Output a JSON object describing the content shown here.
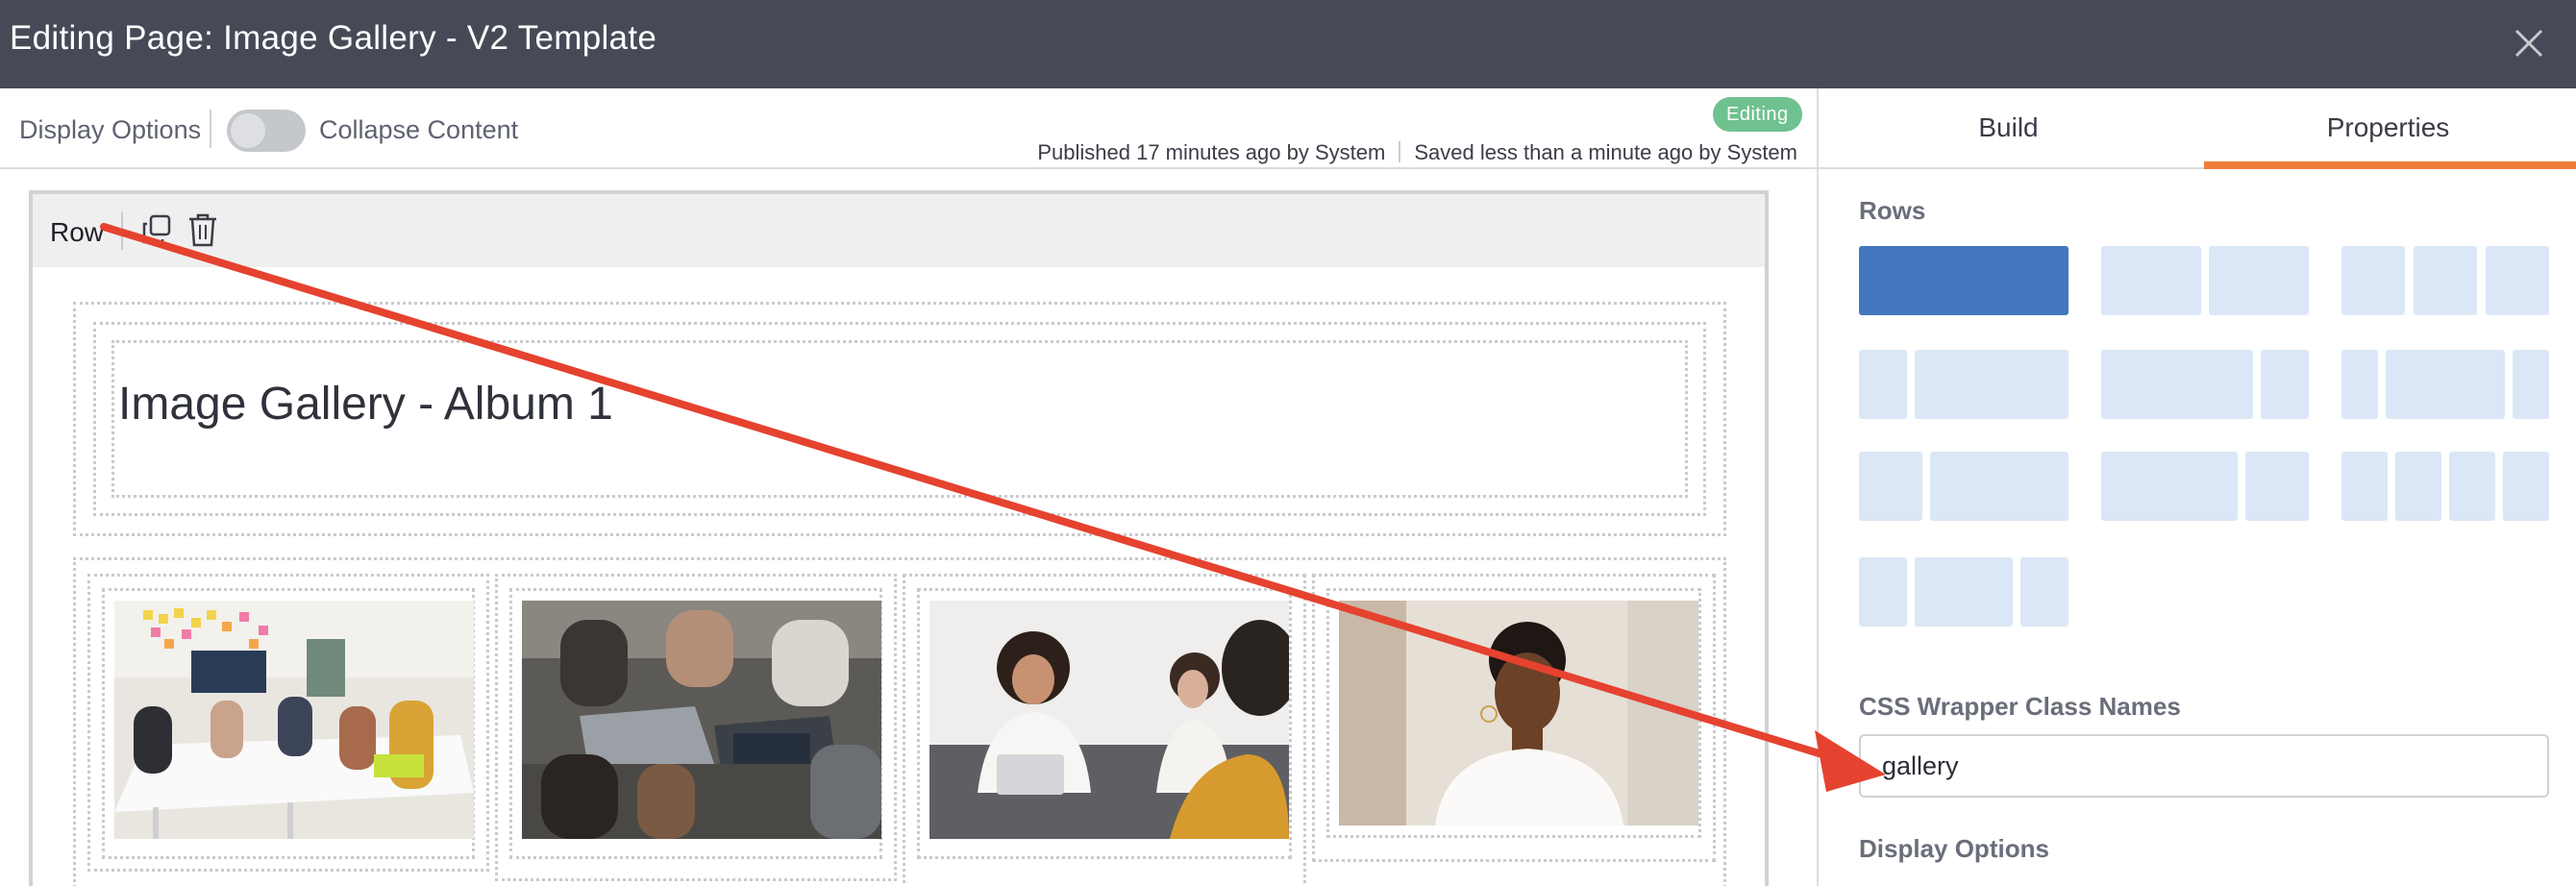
{
  "window": {
    "title": "Editing Page: Image Gallery - V2 Template"
  },
  "toolbar": {
    "display_options_label": "Display Options",
    "collapse_label": "Collapse Content",
    "badge": "Editing",
    "published": "Published 17 minutes ago by System",
    "saved": "Saved less than a minute ago by System"
  },
  "canvas": {
    "row_label": "Row",
    "heading": "Image Gallery - Album 1"
  },
  "panel": {
    "tabs": [
      {
        "label": "Build",
        "active": false
      },
      {
        "label": "Properties",
        "active": true
      }
    ],
    "rows_label": "Rows",
    "css_label": "CSS Wrapper Class Names",
    "css_value": "gallery",
    "display_options_label": "Display Options"
  },
  "colors": {
    "accent": "#ef7d3a",
    "selected_layout": "#4377bd",
    "layout": "#dbe7f6",
    "badge": "#6fc18f",
    "annotation": "#e5422f"
  }
}
